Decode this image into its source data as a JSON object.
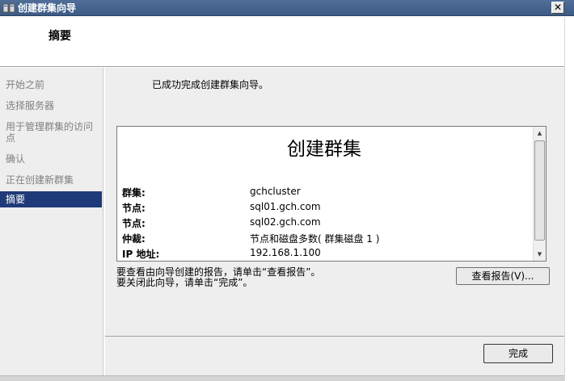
{
  "window": {
    "title": "创建群集向导",
    "close_glyph": "✕"
  },
  "header": {
    "title": "摘要"
  },
  "sidebar": {
    "steps": [
      {
        "label": "开始之前"
      },
      {
        "label": "选择服务器"
      },
      {
        "label": "用于管理群集的访问点"
      },
      {
        "label": "确认"
      },
      {
        "label": "正在创建新群集"
      },
      {
        "label": "摘要"
      }
    ],
    "active_index": 5
  },
  "main": {
    "success_message": "已成功完成创建群集向导。",
    "report": {
      "title": "创建群集",
      "rows": [
        {
          "label": "群集:",
          "value": "gchcluster"
        },
        {
          "label": "节点:",
          "value": "sql01.gch.com"
        },
        {
          "label": "节点:",
          "value": "sql02.gch.com"
        },
        {
          "label": "仲裁:",
          "value": "节点和磁盘多数( 群集磁盘 1 )"
        },
        {
          "label": "IP 地址:",
          "value": "192.168.1.100"
        }
      ]
    },
    "hint_view_report": "要查看由向导创建的报告，请单击“查看报告”。",
    "hint_close": "要关闭此向导，请单击“完成”。",
    "view_report_button": "查看报告(V)...",
    "finish_button": "完成"
  },
  "colors": {
    "titlebar": "#3d5a85",
    "active_step": "#1f3a78",
    "panel": "#eeeeee"
  }
}
